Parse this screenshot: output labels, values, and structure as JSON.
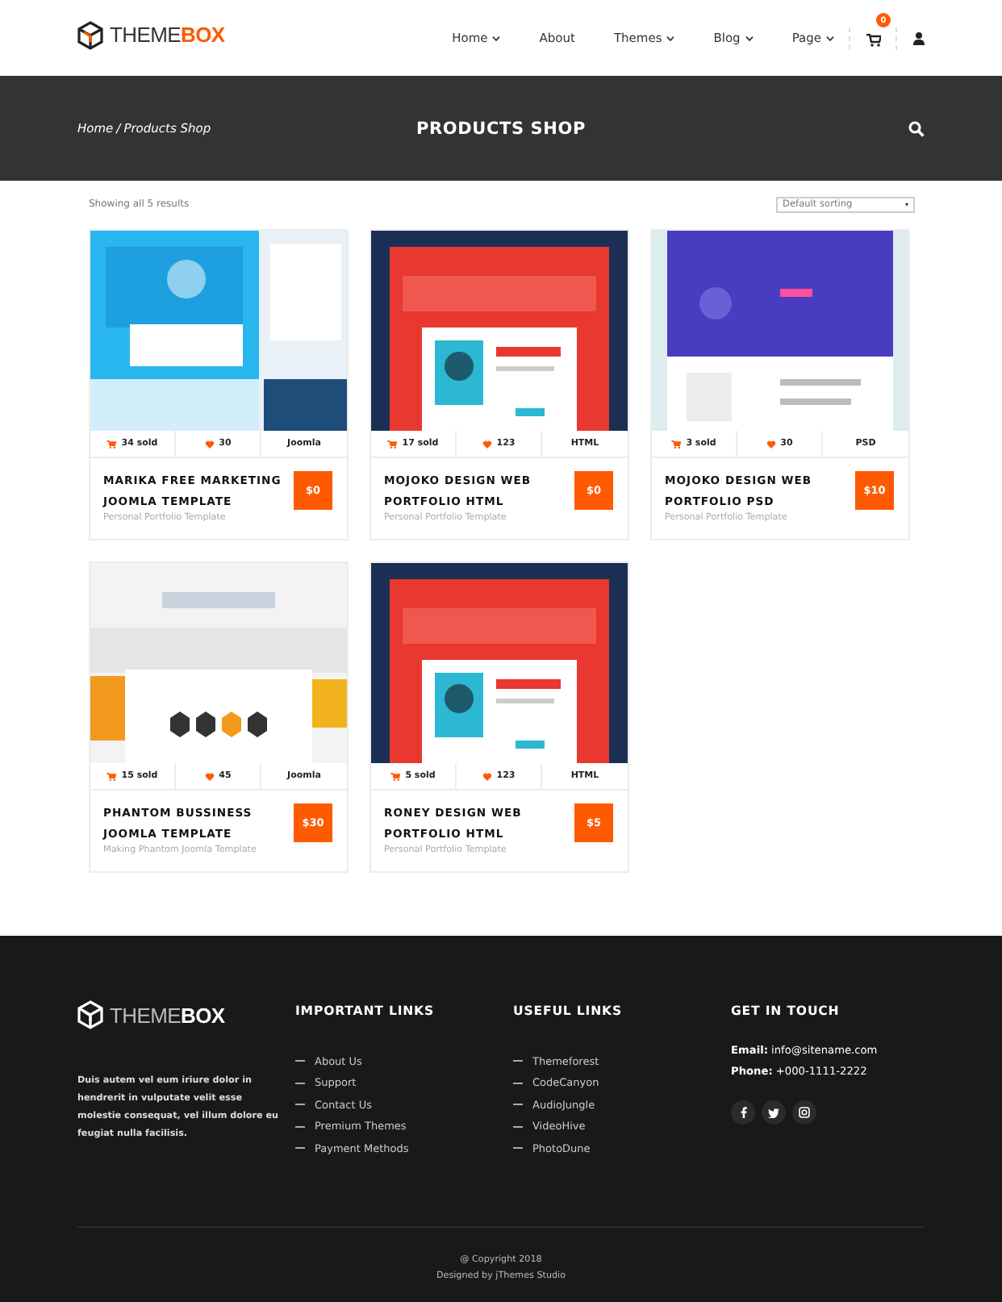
{
  "header": {
    "logo": {
      "first": "THEME",
      "second": "BOX"
    },
    "nav": [
      {
        "label": "Home",
        "dropdown": true
      },
      {
        "label": "About",
        "dropdown": false
      },
      {
        "label": "Themes",
        "dropdown": true
      },
      {
        "label": "Blog",
        "dropdown": true
      },
      {
        "label": "Page",
        "dropdown": true
      }
    ],
    "cart_count": "0"
  },
  "banner": {
    "breadcrumb": [
      {
        "label": "Home"
      },
      {
        "label": "Products Shop"
      }
    ],
    "separator": "/",
    "title": "PRODUCTS SHOP"
  },
  "toolbar": {
    "results": "Showing all 5 results",
    "sort": "Default sorting"
  },
  "products": [
    {
      "sold": "34 sold",
      "likes": "30",
      "category": "Joomla",
      "title": "MARIKA FREE MARKETING JOOMLA TEMPLATE",
      "subtitle": "Personal Portfolio Template",
      "price": "$0"
    },
    {
      "sold": "17 sold",
      "likes": "123",
      "category": "HTML",
      "title": "MOJOKO DESIGN WEB PORTFOLIO HTML",
      "subtitle": "Personal Portfolio Template",
      "price": "$0"
    },
    {
      "sold": "3 sold",
      "likes": "30",
      "category": "PSD",
      "title": "MOJOKO DESIGN WEB PORTFOLIO PSD",
      "subtitle": "Personal Portfolio Template",
      "price": "$10"
    },
    {
      "sold": "15 sold",
      "likes": "45",
      "category": "Joomla",
      "title": "PHANTOM BUSSINESS JOOMLA TEMPLATE",
      "subtitle": "Making Phantom Joomla Template",
      "price": "$30"
    },
    {
      "sold": "5 sold",
      "likes": "123",
      "category": "HTML",
      "title": "RONEY DESIGN WEB PORTFOLIO HTML",
      "subtitle": "Personal Portfolio Template",
      "price": "$5"
    }
  ],
  "footer": {
    "logo": {
      "first": "THEME",
      "second": "BOX"
    },
    "about": "Duis autem vel eum iriure dolor in hendrerit in vulputate velit esse molestie consequat, vel illum dolore eu feugiat nulla facilisis.",
    "columns": [
      {
        "heading": "IMPORTANT LINKS",
        "links": [
          "About Us",
          "Support",
          "Contact Us",
          "Premium Themes",
          "Payment Methods"
        ]
      },
      {
        "heading": "USEFUL LINKS",
        "links": [
          "Themeforest",
          "CodeCanyon",
          "AudioJungle",
          "VideoHive",
          "PhotoDune"
        ]
      }
    ],
    "contact": {
      "heading": "GET IN TOUCH",
      "items": [
        {
          "label": "Email:",
          "value": "info@sitename.com"
        },
        {
          "label": "Phone:",
          "value": "+000-1111-2222"
        }
      ]
    },
    "copyright": [
      "@ Copyright 2018",
      "Designed by jThemes Studio"
    ]
  }
}
